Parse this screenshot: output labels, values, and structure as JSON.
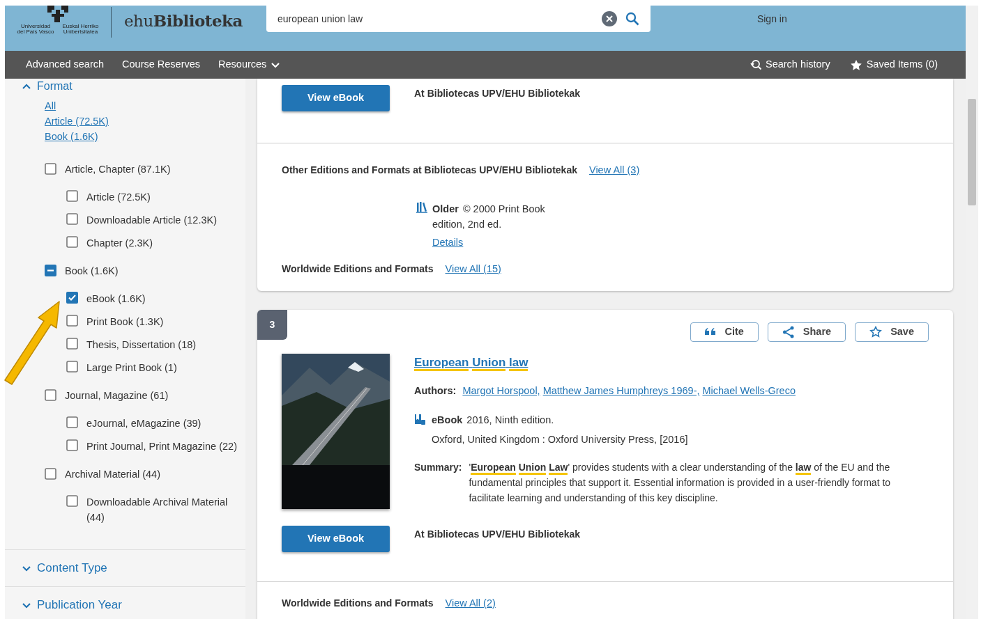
{
  "header": {
    "logo_captions": [
      [
        "Universidad",
        "del País Vasco"
      ],
      [
        "Euskal Herriko",
        "Unibertsitatea"
      ]
    ],
    "site_name": "ehu**Biblioteka**",
    "search": {
      "value": "european union law"
    },
    "sign_in": "Sign in"
  },
  "nav": {
    "left": [
      {
        "label": "Advanced search",
        "dropdown": false
      },
      {
        "label": "Course Reserves",
        "dropdown": false
      },
      {
        "label": "Resources",
        "dropdown": true
      }
    ],
    "right": [
      {
        "label": "Search history"
      },
      {
        "label": "Saved Items (0)"
      }
    ]
  },
  "sidebar": {
    "format": {
      "title": "Format",
      "expanded": true,
      "quick_links": [
        "All",
        "Article (72.5K)",
        "Book (1.6K)"
      ],
      "options": [
        {
          "label": "Article, Chapter (87.1K)",
          "checked": false,
          "mixed": false,
          "children": [
            {
              "label": "Article (72.5K)",
              "checked": false,
              "mixed": false
            },
            {
              "label": "Downloadable Article (12.3K)",
              "checked": false,
              "mixed": false
            },
            {
              "label": "Chapter (2.3K)",
              "checked": false,
              "mixed": false
            }
          ]
        },
        {
          "label": "Book (1.6K)",
          "checked": false,
          "mixed": true,
          "children": [
            {
              "label": "eBook (1.6K)",
              "checked": true,
              "mixed": false
            },
            {
              "label": "Print Book (1.3K)",
              "checked": false,
              "mixed": false
            },
            {
              "label": "Thesis, Dissertation (18)",
              "checked": false,
              "mixed": false
            },
            {
              "label": "Large Print Book (1)",
              "checked": false,
              "mixed": false
            }
          ]
        },
        {
          "label": "Journal, Magazine (61)",
          "checked": false,
          "mixed": false,
          "children": [
            {
              "label": "eJournal, eMagazine (39)",
              "checked": false,
              "mixed": false
            },
            {
              "label": "Print Journal, Print Magazine (22)",
              "checked": false,
              "mixed": false
            }
          ]
        },
        {
          "label": "Archival Material (44)",
          "checked": false,
          "mixed": false,
          "children": [
            {
              "label": "Downloadable Archival Material (44)",
              "checked": false,
              "mixed": false
            }
          ]
        }
      ]
    },
    "sections": [
      {
        "title": "Content Type",
        "expanded": false
      },
      {
        "title": "Publication Year",
        "expanded": false
      }
    ]
  },
  "results": [
    {
      "button": "View eBook",
      "location": "At Bibliotecas UPV/EHU Bibliotekak",
      "other_editions": {
        "label": "Other Editions and Formats at Bibliotecas UPV/EHU Bibliotekak",
        "link": "View All (3)",
        "items": [
          {
            "kind": "print",
            "format": "Older",
            "info": "© 2000 Print Book",
            "line2": "edition, 2nd ed.",
            "link": "Details"
          }
        ]
      },
      "worldwide": {
        "label": "Worldwide Editions and Formats",
        "link": "View All (15)"
      }
    },
    {
      "number": "3",
      "tools": [
        {
          "label": "Cite"
        },
        {
          "label": "Share"
        },
        {
          "label": "Save"
        }
      ],
      "title": "**European** **Union** **law**",
      "authors_label": "Authors:",
      "authors": [
        "Margot Horspool,",
        "Matthew James Humphreys 1969-,",
        "Michael Wells-Greco"
      ],
      "format": {
        "kind": "ebook",
        "label": "eBook",
        "info": "2016, Ninth edition.",
        "publisher": "Oxford, United Kingdom : Oxford University Press, [2016]"
      },
      "summary_label": "Summary:",
      "summary": "'**European** **Union** **Law**' provides students with a clear understanding of the **law** of the EU and the fundamental principles that support it. Essential information is provided in a user-friendly format to facilitate learning and understanding of this key discipline.",
      "button": "View eBook",
      "location": "At Bibliotecas UPV/EHU Bibliotekak",
      "worldwide": {
        "label": "Worldwide Editions and Formats",
        "link": "View All (2)"
      }
    }
  ]
}
